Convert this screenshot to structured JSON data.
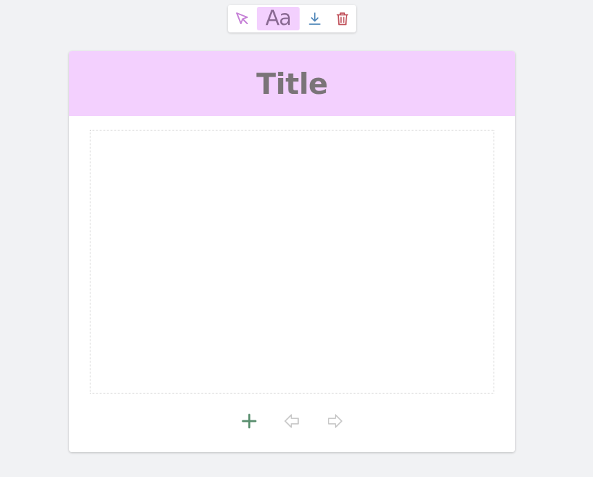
{
  "toolbar": {
    "tools": [
      {
        "name": "select",
        "icon": "cursor-arrow-icon",
        "color": "#c57fd6"
      },
      {
        "name": "text",
        "label": "Aa",
        "active": true,
        "color": "#8a6a93",
        "active_bg": "#f3d0fe"
      },
      {
        "name": "download",
        "icon": "download-icon",
        "color": "#4f86b8"
      },
      {
        "name": "delete",
        "icon": "trash-icon",
        "color": "#c0505a"
      }
    ]
  },
  "card": {
    "title": "Title",
    "header_color": "#f3d0fe",
    "title_color": "#7a7478"
  },
  "controls": {
    "add": {
      "icon": "plus-icon",
      "color": "#5a8f6f"
    },
    "previous": {
      "icon": "arrow-left-outline-icon",
      "color": "#c8c8c8",
      "enabled": false
    },
    "next": {
      "icon": "arrow-right-outline-icon",
      "color": "#c8c8c8",
      "enabled": false
    }
  }
}
